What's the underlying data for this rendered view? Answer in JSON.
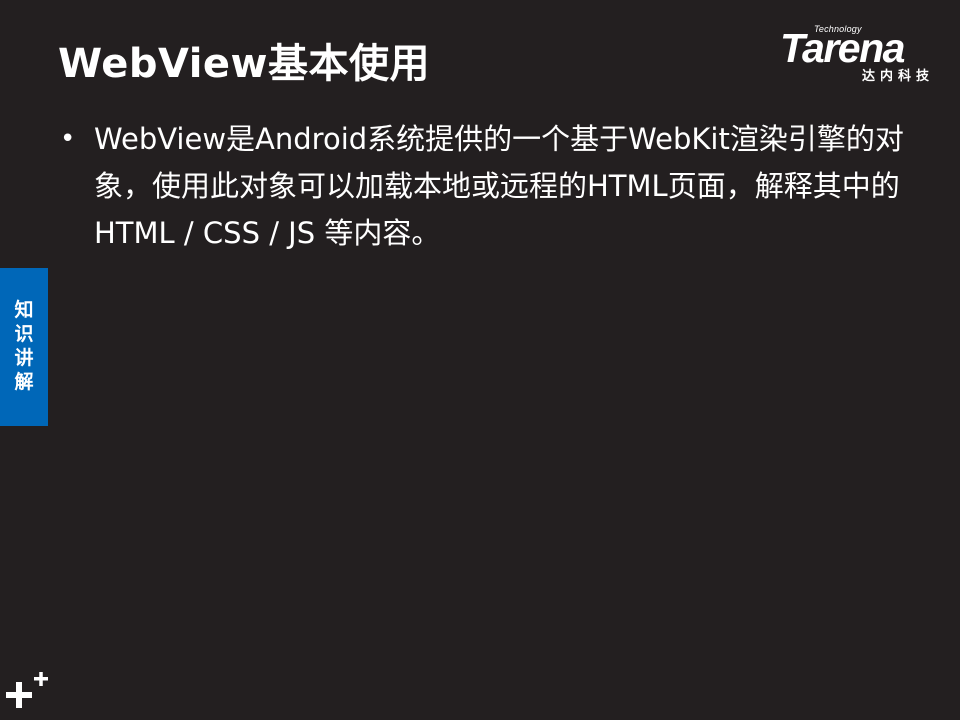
{
  "slide": {
    "title": "WebView基本使用",
    "bullet_marker": "•",
    "bullet_text": "WebView是Android系统提供的一个基于WebKit渲染引擎的对象，使用此对象可以加载本地或远程的HTML页面，解释其中的 HTML / CSS / JS 等内容。"
  },
  "logo": {
    "technology_text": "Technology",
    "brand_text": "Tarena",
    "chinese_text": "达内科技"
  },
  "side_tab": {
    "label": "知识讲解",
    "color": "#0067b8"
  },
  "colors": {
    "background": "#231f20",
    "text": "#ffffff"
  },
  "icons": {
    "corner_decoration": "plus-icon"
  }
}
